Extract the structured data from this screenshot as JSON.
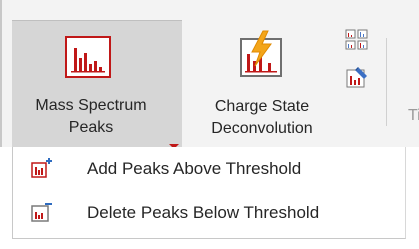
{
  "ribbon": {
    "mass_spectrum_peaks": {
      "line1": "Mass Spectrum",
      "line2": "Peaks",
      "icon": "mass-spectrum-icon"
    },
    "charge_state": {
      "line1": "Charge State",
      "line2": "Deconvolution",
      "icon": "charge-state-deconvolution-icon"
    },
    "small_tools": [
      {
        "icon": "peak-table-icon"
      },
      {
        "icon": "peak-edit-icon"
      }
    ],
    "truncated_label": "Ti"
  },
  "menu": {
    "items": [
      {
        "label": "Add Peaks Above Threshold",
        "icon": "add-peaks-icon"
      },
      {
        "label": "Delete Peaks Below Threshold",
        "icon": "delete-peaks-icon"
      }
    ]
  },
  "colors": {
    "ribbon_bg": "#f3f3f3",
    "selected_button_bg": "#d6d6d6",
    "accent_red": "#c01818",
    "lightning": "#f3a51a"
  }
}
